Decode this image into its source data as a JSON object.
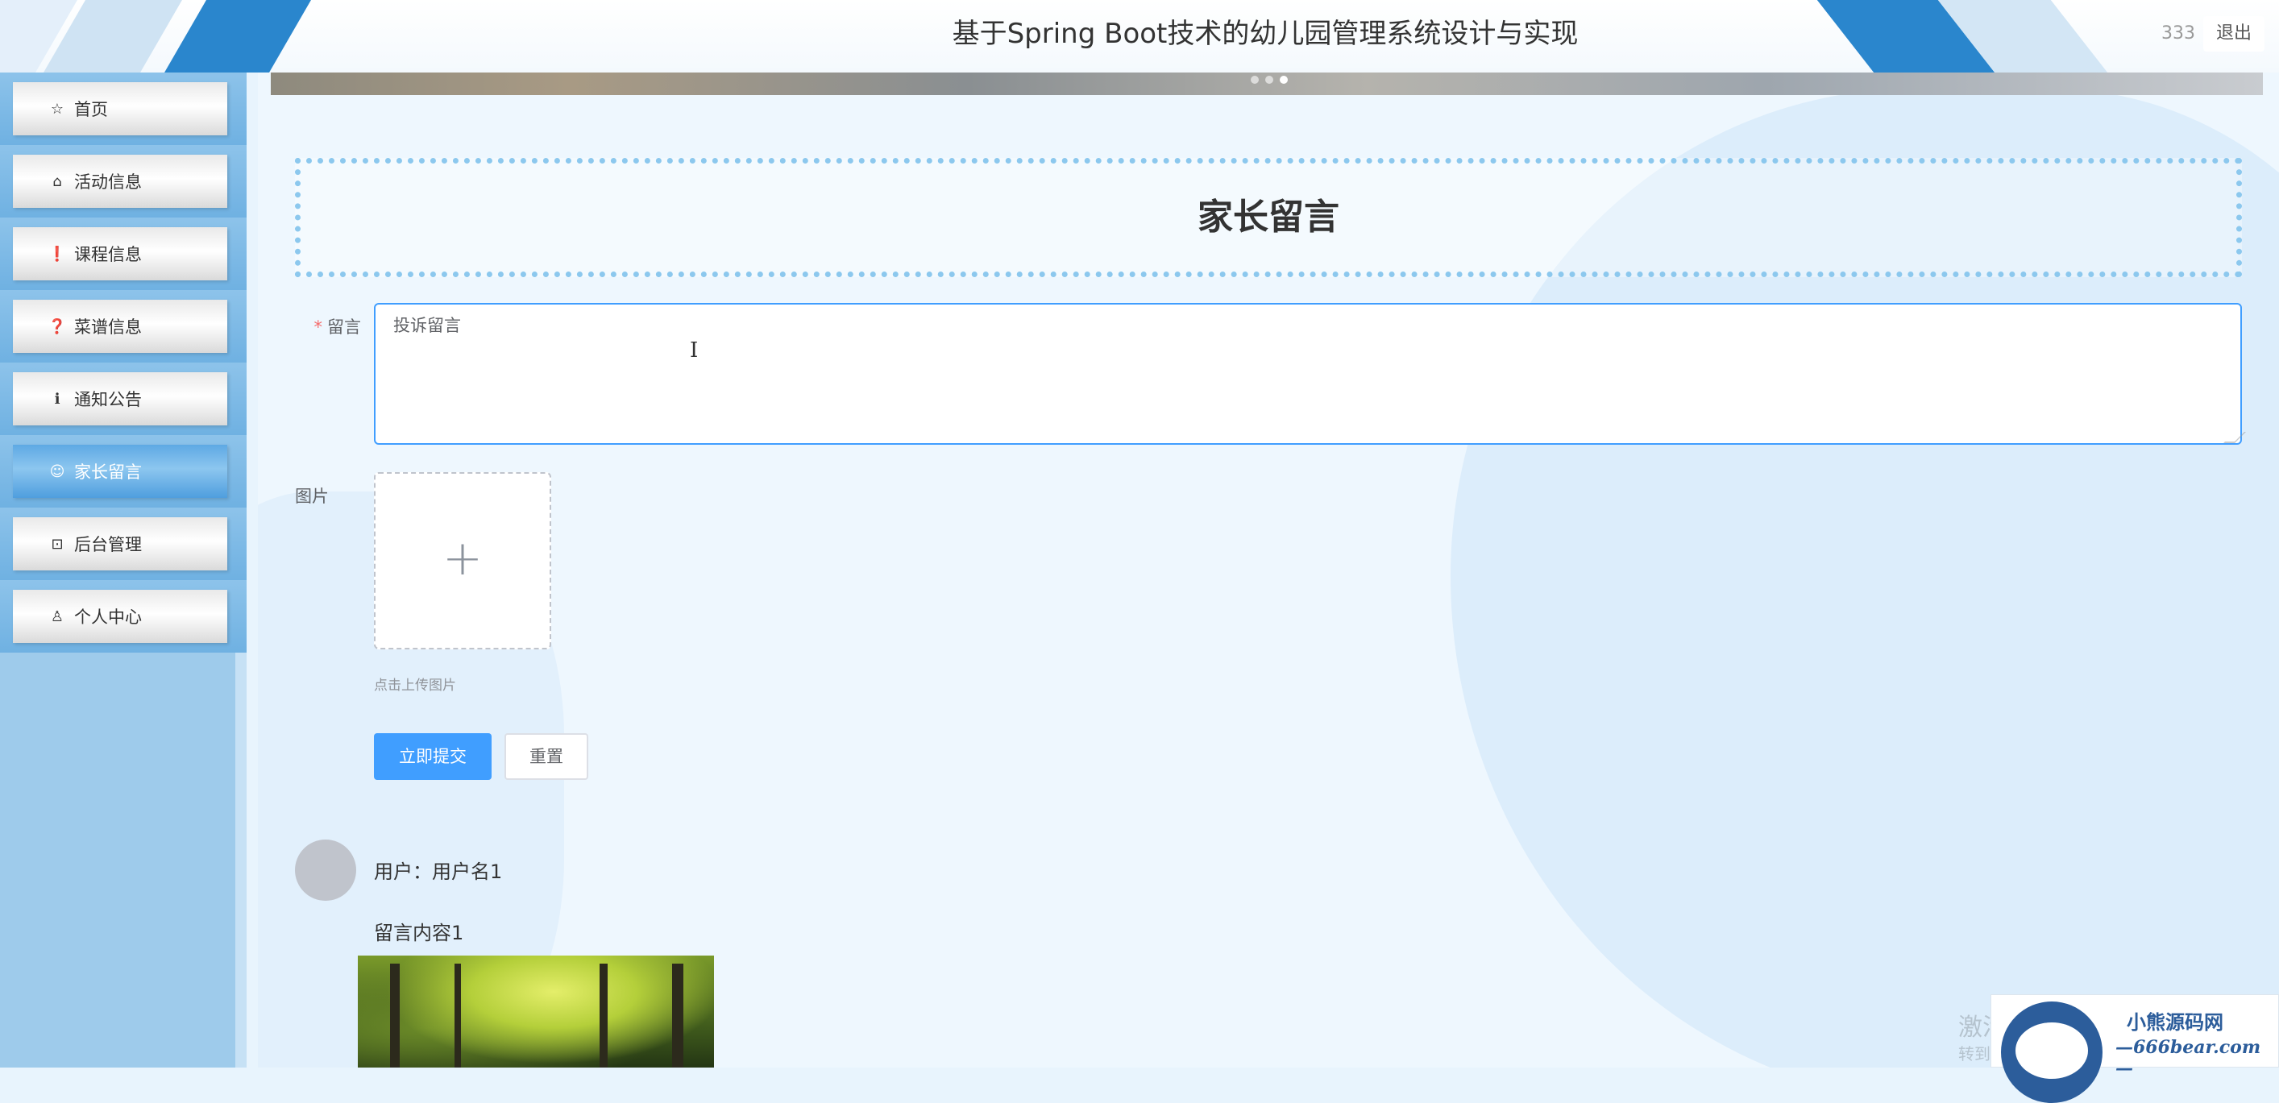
{
  "header": {
    "title": "基于Spring Boot技术的幼儿园管理系统设计与实现",
    "username": "333",
    "logout_label": "退出"
  },
  "sidebar": {
    "items": [
      {
        "label": "首页",
        "icon": "star-icon",
        "glyph": "☆",
        "active": false
      },
      {
        "label": "活动信息",
        "icon": "bag-icon",
        "glyph": "⌂",
        "active": false
      },
      {
        "label": "课程信息",
        "icon": "exclamation-circle-icon",
        "glyph": "❗",
        "active": false
      },
      {
        "label": "菜谱信息",
        "icon": "question-circle-icon",
        "glyph": "❓",
        "active": false
      },
      {
        "label": "通知公告",
        "icon": "info-circle-icon",
        "glyph": "ℹ",
        "active": false
      },
      {
        "label": "家长留言",
        "icon": "smile-icon",
        "glyph": "☺",
        "active": true
      },
      {
        "label": "后台管理",
        "icon": "briefcase-icon",
        "glyph": "⊡",
        "active": false
      },
      {
        "label": "个人中心",
        "icon": "user-icon",
        "glyph": "♙",
        "active": false
      }
    ]
  },
  "page": {
    "title": "家长留言"
  },
  "form": {
    "message_label": "留言",
    "message_value": "投诉留言",
    "image_label": "图片",
    "upload_tip": "点击上传图片",
    "submit_label": "立即提交",
    "reset_label": "重置"
  },
  "comments": [
    {
      "user": "用户：用户名1",
      "content": "留言内容1"
    }
  ],
  "watermark": {
    "name": "小熊源码网",
    "url": "—666bear.com—",
    "text1": "激活",
    "text2": "转到"
  },
  "colors": {
    "accent": "#409eff",
    "sidebar_bg": "#9ecbeb",
    "header_stripe": "#2a86cd"
  }
}
